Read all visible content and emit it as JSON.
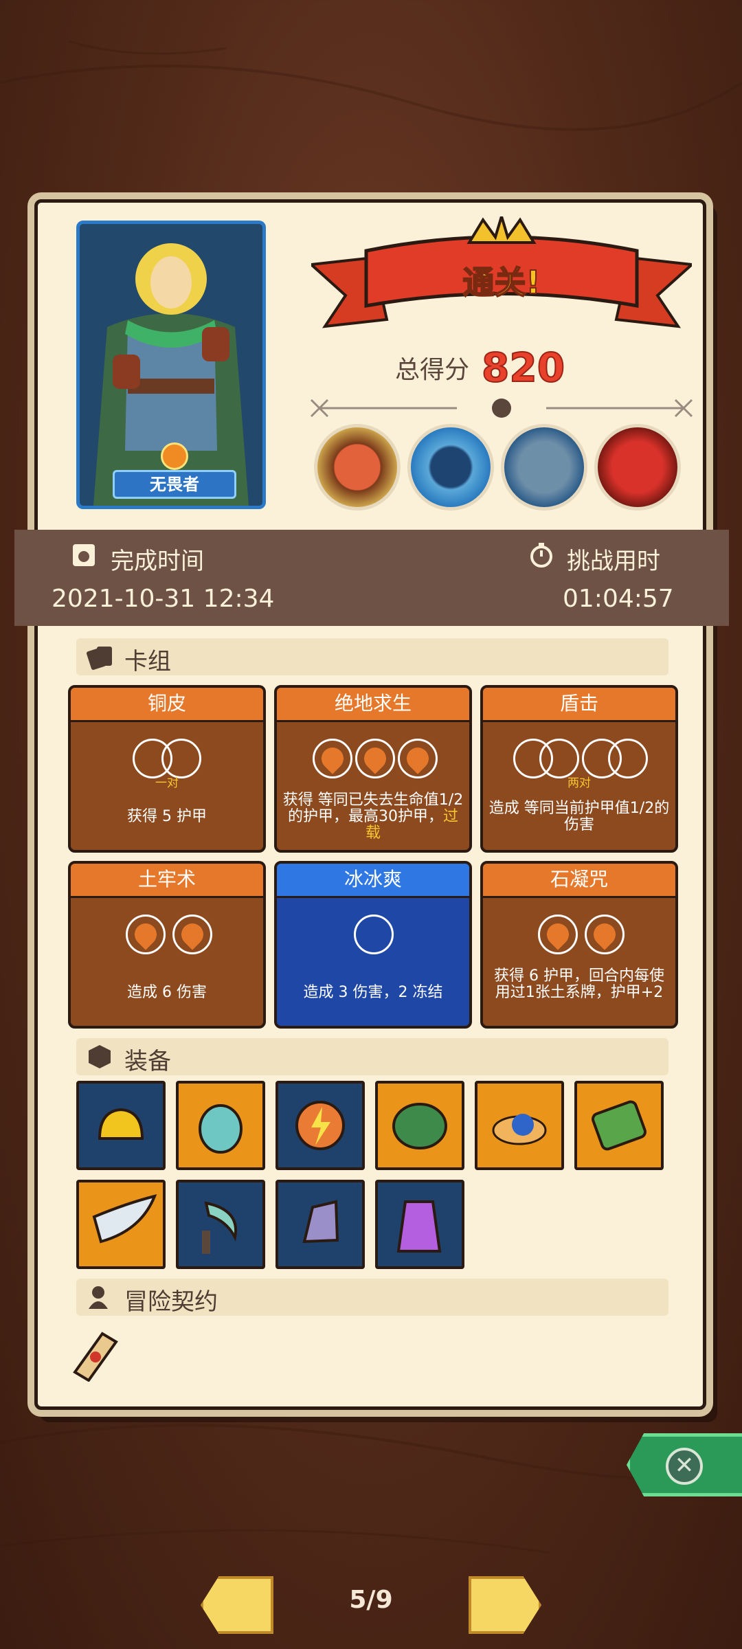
{
  "hero": {
    "name": "无畏者"
  },
  "result": {
    "banner": "通关!",
    "score_label": "总得分",
    "score": "820"
  },
  "bosses": [
    "boss-eye-monster",
    "boss-crowned-squid",
    "boss-bird-knight",
    "boss-red-demon"
  ],
  "times": {
    "complete_label": "完成时间",
    "complete_value": "2021-10-31 12:34",
    "challenge_label": "挑战用时",
    "challenge_value": "01:04:57"
  },
  "sections": {
    "deck": "卡组",
    "equipment": "装备",
    "contract": "冒险契约"
  },
  "cards": [
    {
      "name": "铜皮",
      "tag": "一对",
      "desc": "获得 5 护甲",
      "color": "orange"
    },
    {
      "name": "绝地求生",
      "tag": "",
      "desc": "获得 等同已失去生命值1/2 的护甲，最高30护甲，",
      "desc2": "过载",
      "color": "orange"
    },
    {
      "name": "盾击",
      "tag": "两对",
      "desc": "造成 等同当前护甲值1/2的伤害",
      "color": "orange"
    },
    {
      "name": "土牢术",
      "tag": "",
      "desc": "造成 6 伤害",
      "color": "orange"
    },
    {
      "name": "冰冰爽",
      "tag": "",
      "desc": "造成 3 伤害，2 冻结",
      "color": "blue"
    },
    {
      "name": "石凝咒",
      "tag": "",
      "desc": "获得 6 护甲，回合内每使用过1张土系牌，护甲+2",
      "color": "orange"
    }
  ],
  "equipment": [
    {
      "icon": "golden-helmet-icon",
      "bg": "blue"
    },
    {
      "icon": "teal-vase-icon",
      "bg": "orange"
    },
    {
      "icon": "lightning-orb-icon",
      "bg": "blue"
    },
    {
      "icon": "turtle-shell-icon",
      "bg": "orange"
    },
    {
      "icon": "blue-slime-icon",
      "bg": "orange"
    },
    {
      "icon": "moss-stone-icon",
      "bg": "orange"
    },
    {
      "icon": "horn-icon",
      "bg": "orange"
    },
    {
      "icon": "sickle-icon",
      "bg": "blue"
    },
    {
      "icon": "gauntlet-icon",
      "bg": "blue"
    },
    {
      "icon": "potion-jug-icon",
      "bg": "blue"
    }
  ],
  "contract": {
    "icon": "scroll-icon"
  },
  "pager": {
    "text": "5/9"
  },
  "colors": {
    "accent": "#e8412c",
    "card_orange": "#e5782a",
    "card_blue": "#2f78e4"
  }
}
